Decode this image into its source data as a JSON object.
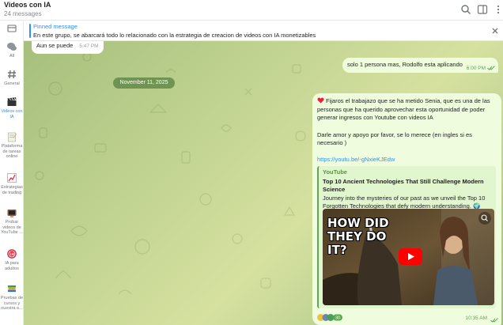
{
  "header": {
    "title": "Videos con IA",
    "subtitle": "24 messages",
    "icons": [
      "search-icon",
      "sidebar-toggle-icon",
      "more-vertical-icon"
    ]
  },
  "sidebar": {
    "items": [
      {
        "label": "",
        "icon": "folder-stack-icon"
      },
      {
        "label": "All",
        "icon": "chats-icon"
      },
      {
        "label": "General",
        "icon": "hash-icon"
      },
      {
        "label": "Videos con\nIA",
        "icon": "clapper-icon",
        "active": true
      },
      {
        "label": "Plataforma\nde tareas\nonline",
        "icon": "notepad-icon"
      },
      {
        "label": "Estrategias\nde trading",
        "icon": "chart-up-icon"
      },
      {
        "label": "Probar\nvideos de\nYouTube ...",
        "icon": "tv-icon"
      },
      {
        "label": "IA para\nadultos",
        "icon": "adults-only-icon"
      },
      {
        "label": "Pruebas de\ncursos y\nnuestra e...",
        "icon": "books-icon"
      }
    ]
  },
  "pinned": {
    "title": "Pinned message",
    "text": "En este grupo, se abarcará todo lo relacionado con la estrategia de creacion de videos con IA monetizables"
  },
  "messages": {
    "m1": {
      "text": "Aun se puede",
      "time": "5:47 PM"
    },
    "m2": {
      "text": "solo 1 persona mas, Rodolfo esta aplicando",
      "time": "6:00 PM"
    },
    "date": "November 11, 2025",
    "m3": {
      "p1": "Fijaros el trabajazo que se ha metido Senia, que es una de las personas que ha querido aprovechar esta oportunidad de poder generar ingresos con Youtube con videos IA",
      "p2": "Darle amor y apoyo por favor, se lo merece (en ingles si es necesario )",
      "link": "https://youtu.be/-gNxieKJEdw",
      "preview": {
        "source": "YouTube",
        "title": "Top 10 Ancient Technologies That Still Challenge Modern Science",
        "description": "Journey into the mysteries of our past as we unveil the Top 10 Forgotten Technologies that defy modern understanding. 🌍 Fr...",
        "thumb_text": "HOW DID THEY DO IT?"
      },
      "reaction_count": "30",
      "time": "10:35 AM"
    }
  },
  "colors": {
    "accent": "#3390ec",
    "out_bubble": "#effdde",
    "out_time": "#5ca853",
    "youtube_red": "#ff0000"
  }
}
